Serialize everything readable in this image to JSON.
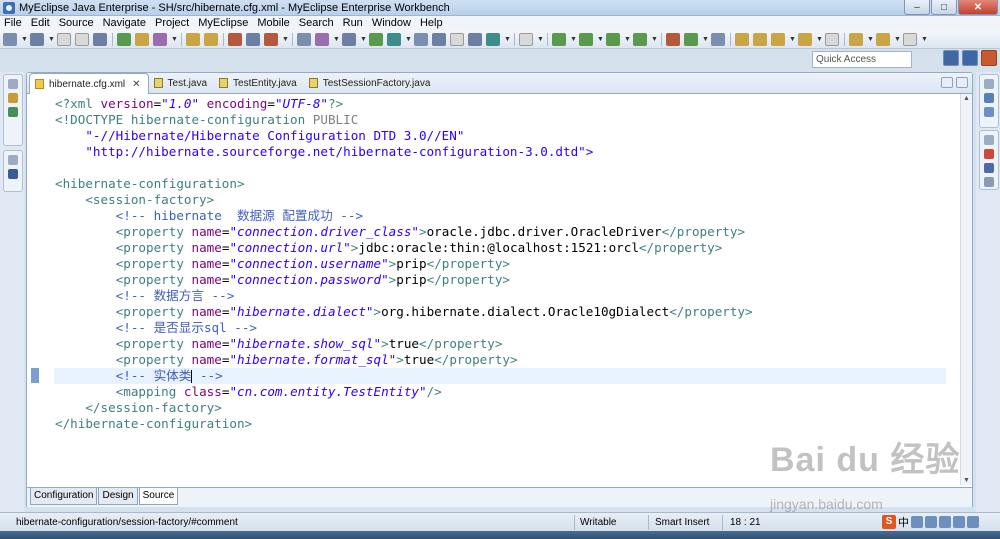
{
  "window": {
    "title": "MyEclipse Java Enterprise - SH/src/hibernate.cfg.xml - MyEclipse Enterprise Workbench",
    "minimize": "–",
    "maximize": "□",
    "close": "✕"
  },
  "menu": [
    "File",
    "Edit",
    "Source",
    "Navigate",
    "Project",
    "MyEclipse",
    "Mobile",
    "Search",
    "Run",
    "Window",
    "Help"
  ],
  "quick_access": {
    "placeholder": "Quick Access"
  },
  "tabs": [
    {
      "label": "hibernate.cfg.xml",
      "type": "xml",
      "active": true,
      "close": "✕"
    },
    {
      "label": "Test.java",
      "type": "java",
      "active": false
    },
    {
      "label": "TestEntity.java",
      "type": "java",
      "active": false
    },
    {
      "label": "TestSessionFactory.java",
      "type": "java",
      "active": false
    }
  ],
  "code": {
    "l1a": "<?xml ",
    "l1b": "version",
    "l1c": "=",
    "l1d": "\"1.0\"",
    "l1e": " encoding",
    "l1f": "=",
    "l1g": "\"UTF-8\"",
    "l1h": "?>",
    "l2a": "<!DOCTYPE hibernate-configuration ",
    "l2b": "PUBLIC",
    "l3": "    \"-//Hibernate/Hibernate Configuration DTD 3.0//EN\"",
    "l4": "    \"http://hibernate.sourceforge.net/hibernate-configuration-3.0.dtd\">",
    "l6": "<hibernate-configuration>",
    "l7": "    <session-factory>",
    "l8": "        <!-- hibernate  数据源 配置成功 -->",
    "prop_open": "<property ",
    "name_attr": "name",
    "eq": "=",
    "p1_name": "\"connection.driver_class\"",
    "p1_val": "oracle.jdbc.driver.OracleDriver",
    "p2_name": "\"connection.url\"",
    "p2_val": "jdbc:oracle:thin:@localhost:1521:orcl",
    "p3_name": "\"connection.username\"",
    "p3_val": "prip",
    "p4_name": "\"connection.password\"",
    "p4_val": "prip",
    "l13": "        <!-- 数据方言 -->",
    "p5_name": "\"hibernate.dialect\"",
    "p5_val": "org.hibernate.dialect.Oracle10gDialect",
    "l15": "        <!-- 是否显示sql -->",
    "p6_name": "\"hibernate.show_sql\"",
    "p6_val": "true",
    "p7_name": "\"hibernate.format_sql\"",
    "p7_val": "true",
    "l18a": "        <!-- 实体类",
    "l18b": " -->",
    "map_open": "<mapping ",
    "class_attr": "class",
    "map_val": "\"cn.com.entity.TestEntity\"",
    "map_close": "/>",
    "close_gt": ">",
    "prop_close": "</property>",
    "indent8": "        ",
    "l20": "    </session-factory>",
    "l21": "</hibernate-configuration>"
  },
  "bottom_tabs": [
    "Configuration",
    "Design",
    "Source"
  ],
  "status": {
    "path": "hibernate-configuration/session-factory/#comment",
    "mode": "Writable",
    "insert": "Smart Insert",
    "position": "18 : 21",
    "ime_s": "S",
    "ime_lang": "中"
  },
  "watermark": {
    "logo": "Bai du 经验",
    "url": "jingyan.baidu.com"
  }
}
